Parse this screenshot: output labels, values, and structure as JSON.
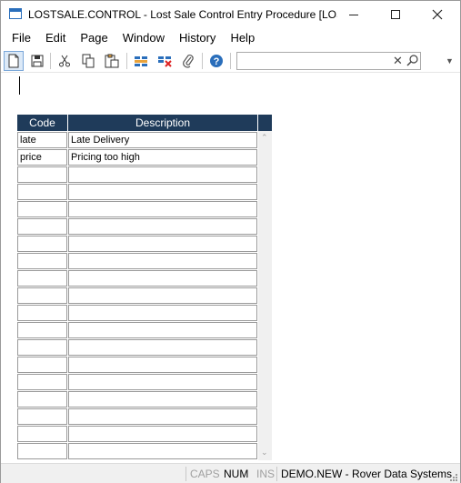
{
  "window": {
    "title": "LOSTSALE.CONTROL - Lost Sale Control Entry Procedure [LOSTSAL..."
  },
  "menu": {
    "items": [
      "File",
      "Edit",
      "Page",
      "Window",
      "History",
      "Help"
    ]
  },
  "toolbar": {
    "search_value": "",
    "buttons": [
      "new-document-icon",
      "save-icon",
      "cut-icon",
      "copy-icon",
      "paste-icon",
      "insert-row-icon",
      "delete-row-icon",
      "attach-icon",
      "help-icon"
    ]
  },
  "grid": {
    "columns": [
      "Code",
      "Description"
    ],
    "rows": [
      {
        "code": "late",
        "description": "Late Delivery"
      },
      {
        "code": "price",
        "description": "Pricing too high"
      },
      {
        "code": "",
        "description": ""
      },
      {
        "code": "",
        "description": ""
      },
      {
        "code": "",
        "description": ""
      },
      {
        "code": "",
        "description": ""
      },
      {
        "code": "",
        "description": ""
      },
      {
        "code": "",
        "description": ""
      },
      {
        "code": "",
        "description": ""
      },
      {
        "code": "",
        "description": ""
      },
      {
        "code": "",
        "description": ""
      },
      {
        "code": "",
        "description": ""
      },
      {
        "code": "",
        "description": ""
      },
      {
        "code": "",
        "description": ""
      },
      {
        "code": "",
        "description": ""
      },
      {
        "code": "",
        "description": ""
      },
      {
        "code": "",
        "description": ""
      },
      {
        "code": "",
        "description": ""
      },
      {
        "code": "",
        "description": ""
      }
    ]
  },
  "status": {
    "caps": "CAPS",
    "num": "NUM",
    "ins": "INS",
    "system": "DEMO.NEW - Rover Data Systems"
  },
  "colors": {
    "header_bg": "#1f3b5a",
    "accent": "#2a6ebb"
  }
}
